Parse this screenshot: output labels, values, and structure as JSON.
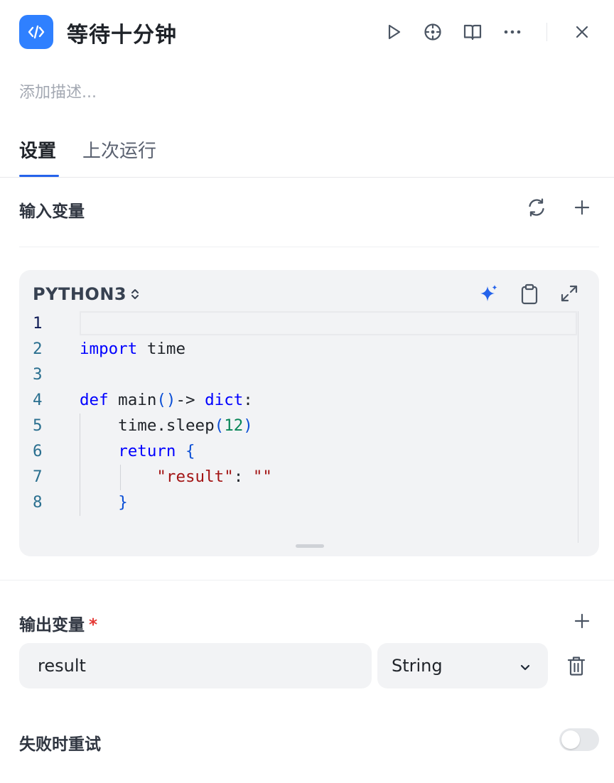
{
  "header": {
    "icon": "code-icon",
    "title": "等待十分钟",
    "actions": [
      "play-icon",
      "crosshair-icon",
      "book-icon",
      "more-icon",
      "close-icon"
    ],
    "accent": "#2f80ff"
  },
  "description": {
    "placeholder": "添加描述..."
  },
  "tabs": [
    {
      "label": "设置",
      "active": true
    },
    {
      "label": "上次运行",
      "active": false
    }
  ],
  "input_vars": {
    "label": "输入变量",
    "actions": [
      "refresh-icon",
      "plus-icon"
    ]
  },
  "code": {
    "language": "PYTHON3",
    "tools": [
      "sparkle-icon",
      "clipboard-icon",
      "expand-icon"
    ],
    "lines": [
      {
        "n": "1",
        "text": ""
      },
      {
        "n": "2",
        "text": "import time"
      },
      {
        "n": "3",
        "text": ""
      },
      {
        "n": "4",
        "text": "def main()-> dict:"
      },
      {
        "n": "5",
        "text": "    time.sleep(12)"
      },
      {
        "n": "6",
        "text": "    return {"
      },
      {
        "n": "7",
        "text": "        \"result\": \"\""
      },
      {
        "n": "8",
        "text": "    }"
      }
    ]
  },
  "output_vars": {
    "label": "输出变量",
    "required_mark": "*",
    "rows": [
      {
        "name": "result",
        "type": "String"
      }
    ]
  },
  "retry": {
    "label": "失败时重试",
    "enabled": false
  }
}
